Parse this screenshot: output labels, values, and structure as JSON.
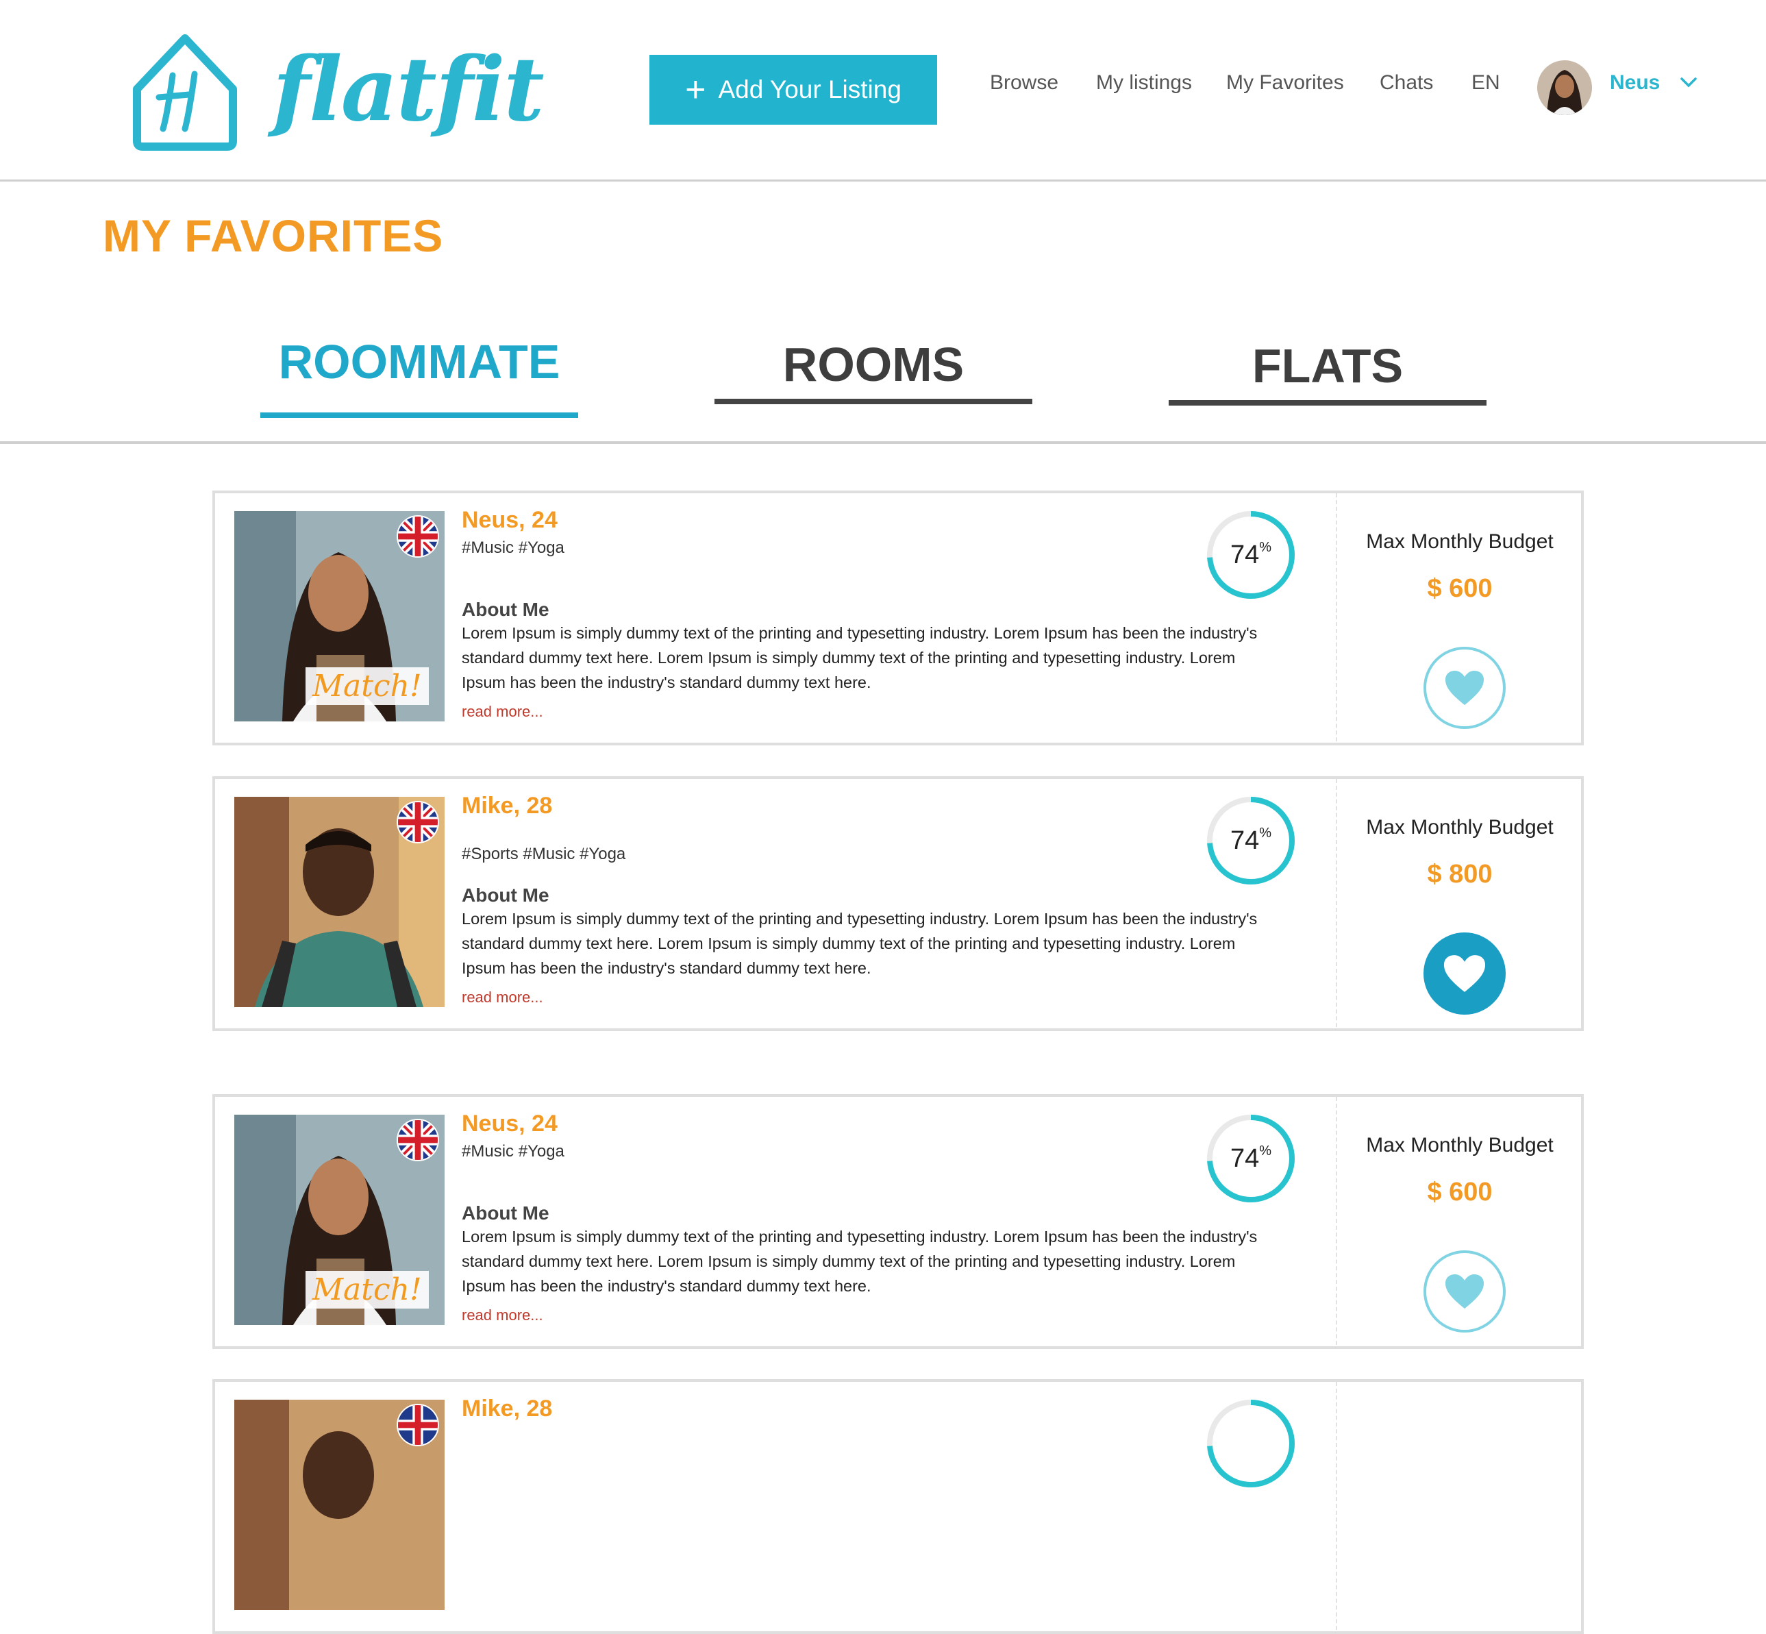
{
  "header": {
    "logo_text": "flatfit",
    "add_listing_label": "Add Your Listing",
    "nav": [
      {
        "label": "Browse"
      },
      {
        "label": "My listings"
      },
      {
        "label": "My Favorites"
      },
      {
        "label": "Chats"
      },
      {
        "label": "EN"
      }
    ],
    "user_name": "Neus"
  },
  "page_title": "MY FAVORITES",
  "tabs": [
    {
      "label": "ROOMMATE",
      "active": true
    },
    {
      "label": "ROOMS",
      "active": false
    },
    {
      "label": "FLATS",
      "active": false
    }
  ],
  "listings": [
    {
      "name": "Neus, 24",
      "tags": "#Music #Yoga",
      "about_heading": "About Me",
      "about_text": "Lorem Ipsum is simply dummy text of the printing and typesetting industry. Lorem Ipsum has been the industry's standard dummy text here. Lorem Ipsum is simply dummy text of the printing and typesetting industry. Lorem Ipsum has been the industry's standard dummy text here.",
      "read_more": "read more...",
      "match_label": "Match!",
      "score_value": "74",
      "score_unit": "%",
      "budget_label": "Max Monthly Budget",
      "budget_value": "$ 600",
      "favorite_state": "outline"
    },
    {
      "name": "Mike, 28",
      "tags": "#Sports #Music #Yoga",
      "about_heading": "About Me",
      "about_text": "Lorem Ipsum is simply dummy text of the printing and typesetting industry. Lorem Ipsum has been the industry's standard dummy text here. Lorem Ipsum is simply dummy text of the printing and typesetting industry. Lorem Ipsum has been the industry's standard dummy text here.",
      "read_more": "read more...",
      "score_value": "74",
      "score_unit": "%",
      "budget_label": "Max Monthly Budget",
      "budget_value": "$ 800",
      "favorite_state": "filled"
    },
    {
      "name": "Neus, 24",
      "tags": "#Music #Yoga",
      "about_heading": "About Me",
      "about_text": "Lorem Ipsum is simply dummy text of the printing and typesetting industry. Lorem Ipsum has been the industry's standard dummy text here. Lorem Ipsum is simply dummy text of the printing and typesetting industry. Lorem Ipsum has been the industry's standard dummy text here.",
      "read_more": "read more...",
      "match_label": "Match!",
      "score_value": "74",
      "score_unit": "%",
      "budget_label": "Max Monthly Budget",
      "budget_value": "$ 600",
      "favorite_state": "outline"
    },
    {
      "name": "Mike, 28"
    }
  ],
  "score_fraction": 0.74,
  "colors": {
    "brand": "#2bb5cf",
    "accent_orange": "#f39a25",
    "favorite_filled": "#1a9ec4",
    "favorite_outline": "#7fd3e2"
  },
  "icons": [
    "house-logo-icon",
    "plus-icon",
    "chevron-down-icon",
    "uk-flag-icon",
    "heart-icon"
  ]
}
